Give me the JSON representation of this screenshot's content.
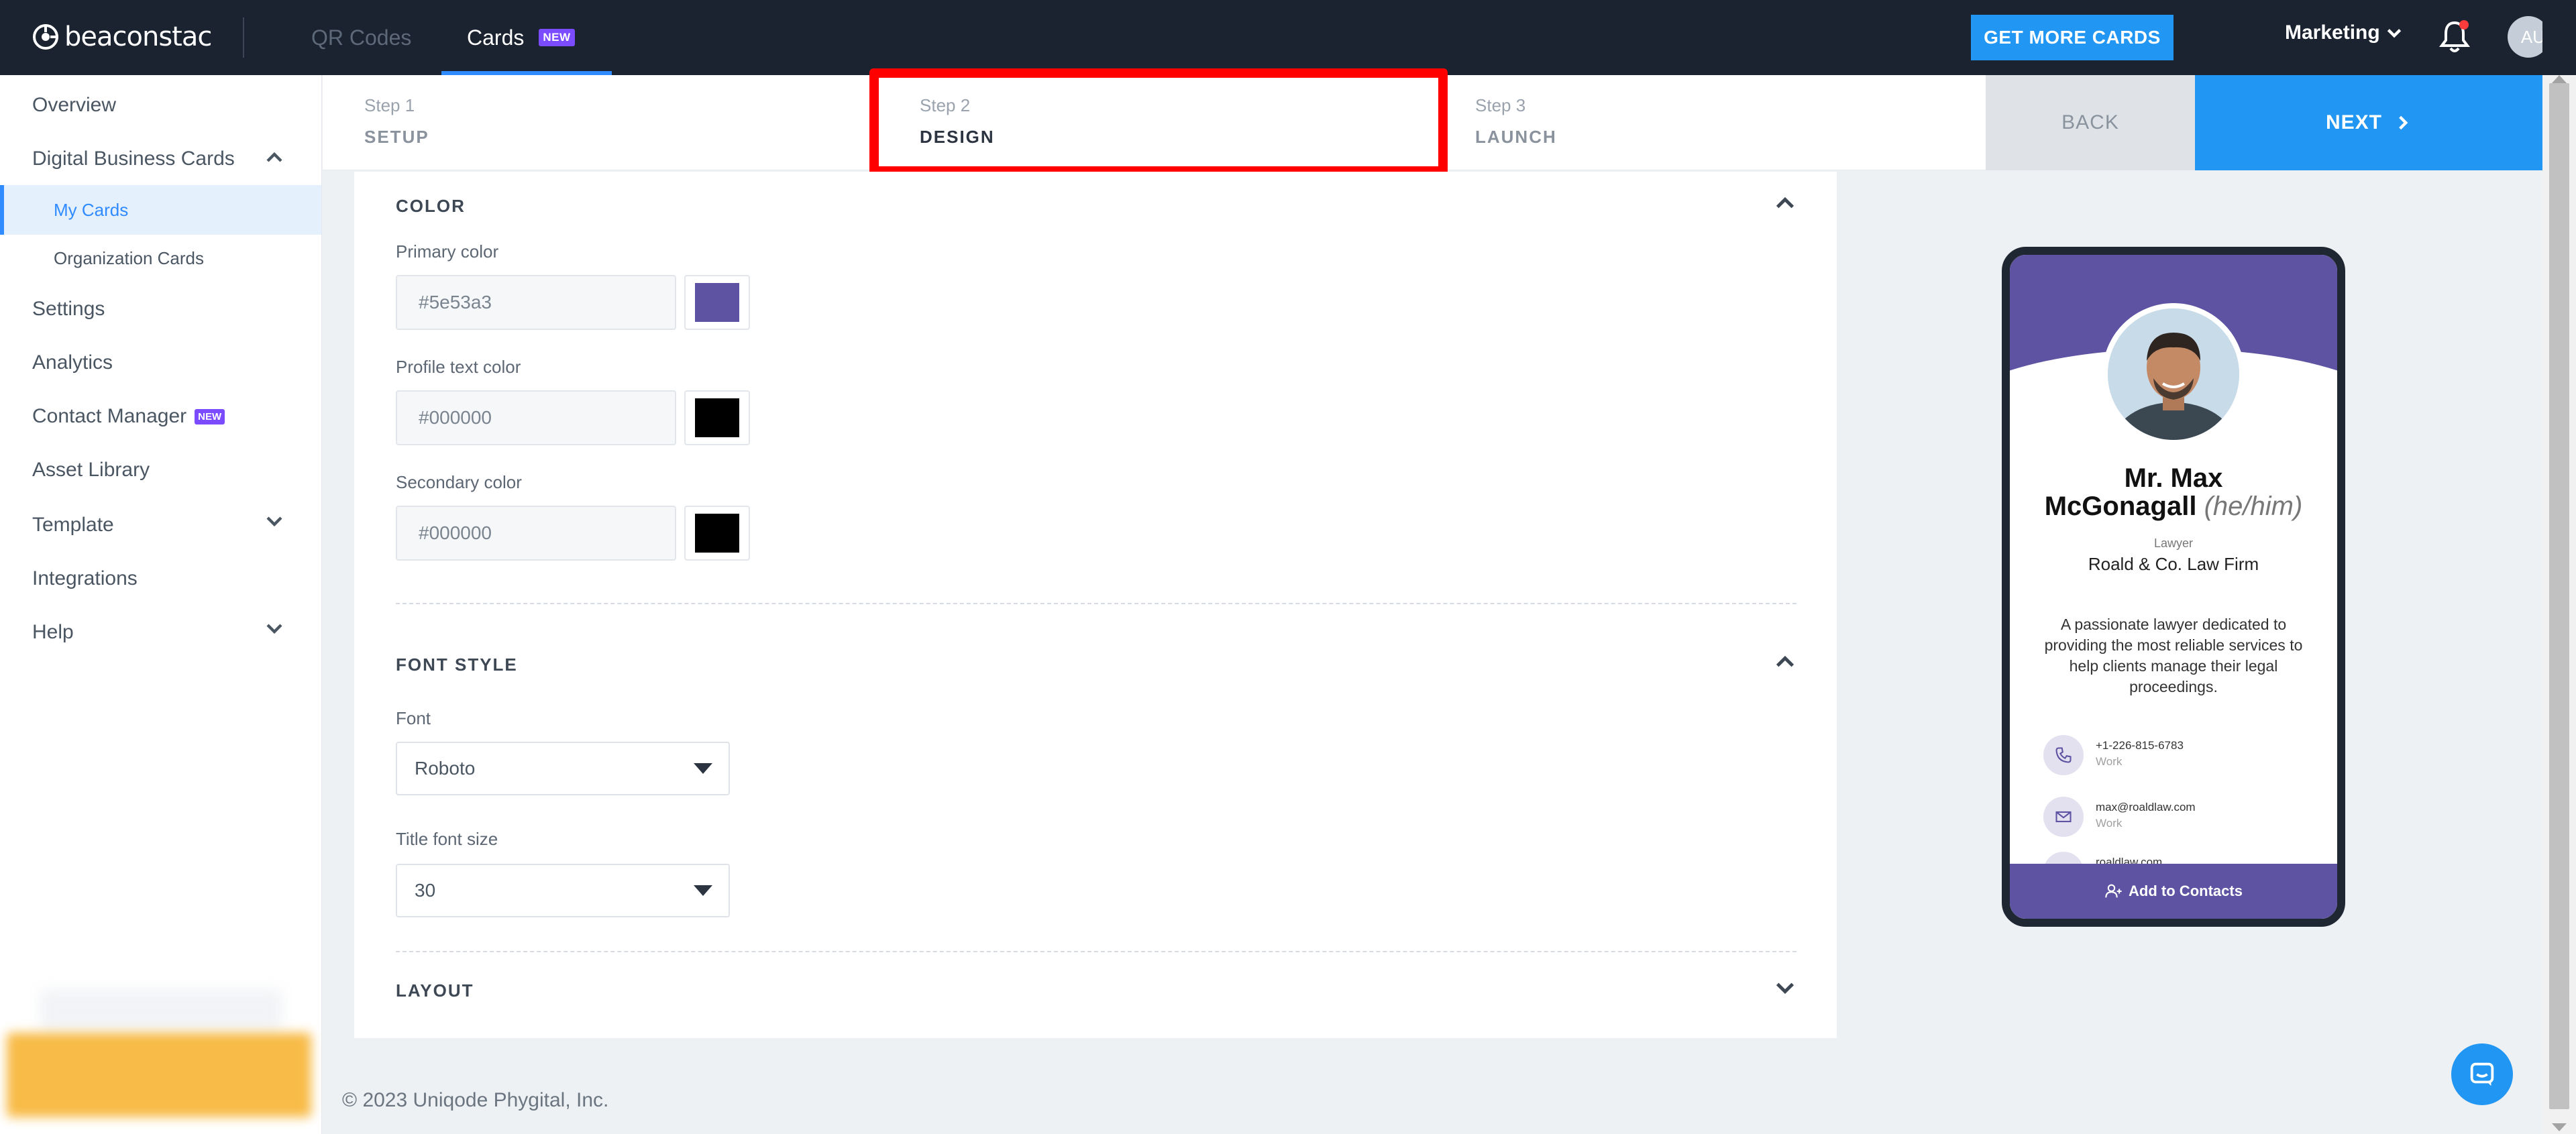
{
  "topbar": {
    "logo_text": "beaconstac",
    "tabs": [
      {
        "label": "QR Codes"
      },
      {
        "label": "Cards",
        "badge": "NEW"
      }
    ],
    "get_more_label": "GET MORE CARDS",
    "workspace_label": "Marketing",
    "avatar_initials": "AU",
    "accent_color": "#2f8bff",
    "cta_color": "#2196f3"
  },
  "sidebar": {
    "items": [
      {
        "label": "Overview"
      },
      {
        "label": "Digital Business Cards",
        "expanded": true
      },
      {
        "label": "My Cards",
        "active": true
      },
      {
        "label": "Organization Cards"
      },
      {
        "label": "Settings"
      },
      {
        "label": "Analytics"
      },
      {
        "label": "Contact Manager",
        "badge": "NEW"
      },
      {
        "label": "Asset Library"
      },
      {
        "label": "Template"
      },
      {
        "label": "Integrations"
      },
      {
        "label": "Help"
      }
    ]
  },
  "stepper": {
    "steps": [
      {
        "num": "Step 1",
        "name": "SETUP"
      },
      {
        "num": "Step 2",
        "name": "DESIGN",
        "current": true
      },
      {
        "num": "Step 3",
        "name": "LAUNCH"
      }
    ],
    "back_label": "BACK",
    "next_label": "NEXT"
  },
  "design": {
    "color_section": {
      "title": "COLOR",
      "primary_label": "Primary color",
      "primary_value": "#5e53a3",
      "profile_text_label": "Profile text color",
      "profile_text_value": "#000000",
      "secondary_label": "Secondary color",
      "secondary_value": "#000000"
    },
    "font_section": {
      "title": "FONT STYLE",
      "font_label": "Font",
      "font_value": "Roboto",
      "title_size_label": "Title font size",
      "title_size_value": "30"
    },
    "layout_section": {
      "title": "LAYOUT"
    }
  },
  "preview": {
    "name_line1": "Mr. Max",
    "name_line2": "McGonagall",
    "pronouns": "(he/him)",
    "job_title": "Lawyer",
    "company": "Roald & Co. Law Firm",
    "bio": "A passionate lawyer dedicated to providing the most reliable services to help clients manage their legal proceedings.",
    "contacts": [
      {
        "value": "+1-226-815-6783",
        "type": "Work",
        "icon": "phone-icon"
      },
      {
        "value": "max@roaldlaw.com",
        "type": "Work",
        "icon": "email-icon"
      },
      {
        "value": "roaldlaw.com",
        "type": "",
        "icon": "globe-icon"
      }
    ],
    "cta_label": "Add to Contacts"
  },
  "footer": {
    "copyright": "© 2023 Uniqode Phygital, Inc."
  }
}
